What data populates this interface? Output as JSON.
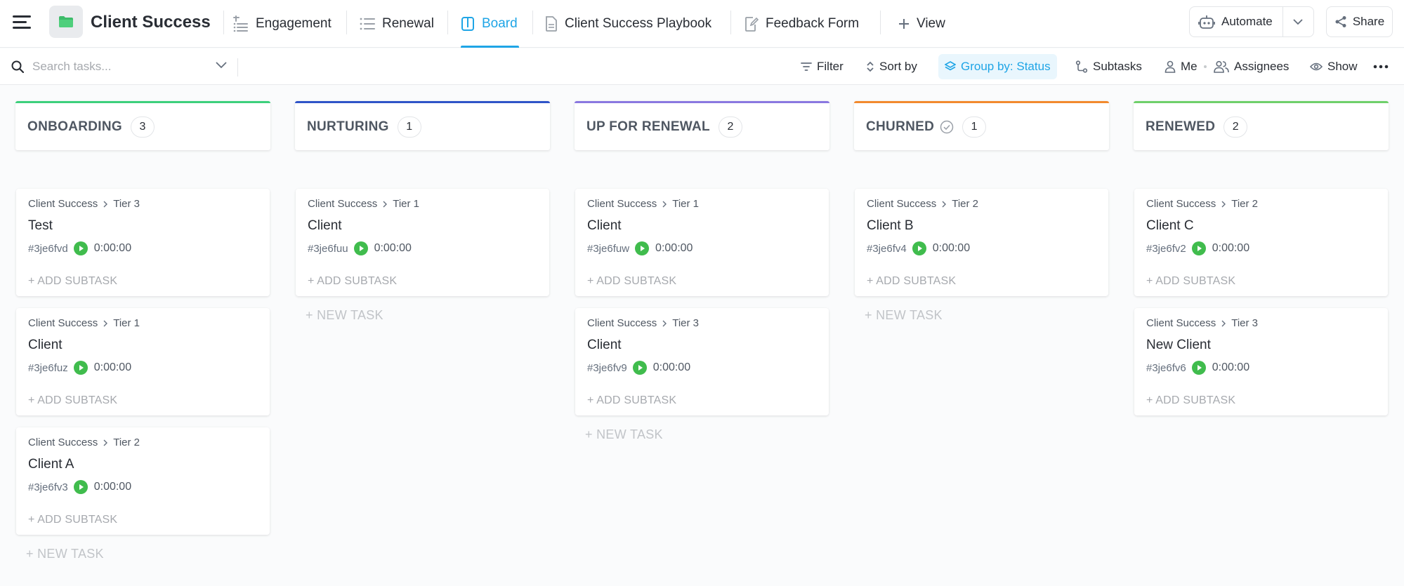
{
  "header": {
    "space_title": "Client Success",
    "tabs": [
      {
        "label": "Engagement",
        "icon": "gantt-icon"
      },
      {
        "label": "Renewal",
        "icon": "list-icon"
      },
      {
        "label": "Board",
        "icon": "board-icon",
        "active": true
      },
      {
        "label": "Client Success Playbook",
        "icon": "doc-icon"
      },
      {
        "label": "Feedback Form",
        "icon": "form-icon"
      }
    ],
    "add_view_label": "View",
    "automate_label": "Automate",
    "share_label": "Share",
    "accent_color": "#1fa5e6"
  },
  "toolbar": {
    "search_placeholder": "Search tasks...",
    "filter_label": "Filter",
    "sort_label": "Sort by",
    "group_label": "Group by: Status",
    "subtasks_label": "Subtasks",
    "me_label": "Me",
    "assignees_label": "Assignees",
    "show_label": "Show"
  },
  "board": {
    "add_subtask_label": "+ ADD SUBTASK",
    "new_task_label": "+ NEW TASK",
    "columns": [
      {
        "title": "ONBOARDING",
        "count": "3",
        "color": "#3dd07c",
        "cards": [
          {
            "space": "Client Success",
            "list": "Tier 3",
            "title": "Test",
            "id": "#3je6fvd",
            "time": "0:00:00"
          },
          {
            "space": "Client Success",
            "list": "Tier 1",
            "title": "Client",
            "id": "#3je6fuz",
            "time": "0:00:00"
          },
          {
            "space": "Client Success",
            "list": "Tier 2",
            "title": "Client A",
            "id": "#3je6fv3",
            "time": "0:00:00"
          }
        ]
      },
      {
        "title": "NURTURING",
        "count": "1",
        "color": "#2f54c8",
        "cards": [
          {
            "space": "Client Success",
            "list": "Tier 1",
            "title": "Client",
            "id": "#3je6fuu",
            "time": "0:00:00"
          }
        ]
      },
      {
        "title": "UP FOR RENEWAL",
        "count": "2",
        "color": "#8a78e0",
        "cards": [
          {
            "space": "Client Success",
            "list": "Tier 1",
            "title": "Client",
            "id": "#3je6fuw",
            "time": "0:00:00"
          },
          {
            "space": "Client Success",
            "list": "Tier 3",
            "title": "Client",
            "id": "#3je6fv9",
            "time": "0:00:00"
          }
        ]
      },
      {
        "title": "CHURNED",
        "count": "1",
        "color": "#f28a2e",
        "closed": true,
        "cards": [
          {
            "space": "Client Success",
            "list": "Tier 2",
            "title": "Client B",
            "id": "#3je6fv4",
            "time": "0:00:00"
          }
        ]
      },
      {
        "title": "RENEWED",
        "count": "2",
        "color": "#6fd06a",
        "cards": [
          {
            "space": "Client Success",
            "list": "Tier 2",
            "title": "Client C",
            "id": "#3je6fv2",
            "time": "0:00:00"
          },
          {
            "space": "Client Success",
            "list": "Tier 3",
            "title": "New Client",
            "id": "#3je6fv6",
            "time": "0:00:00"
          }
        ]
      }
    ]
  }
}
